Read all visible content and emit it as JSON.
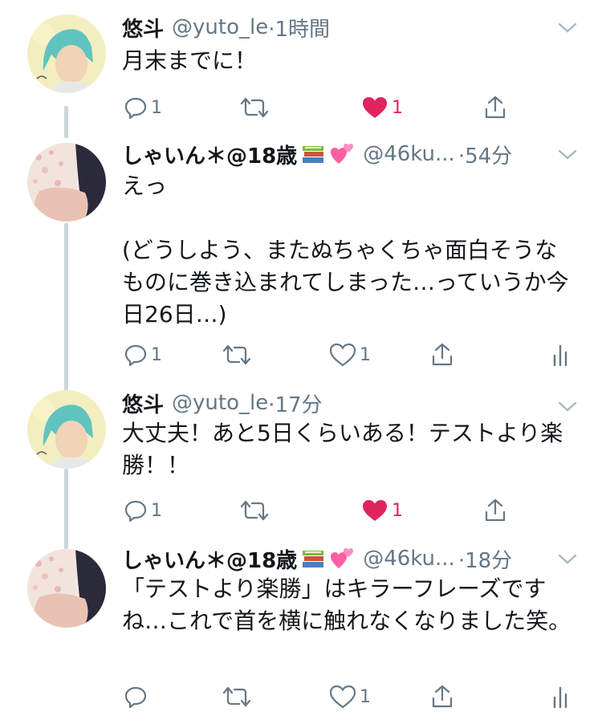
{
  "tweets": [
    {
      "name": "悠斗",
      "handle": "@yuto_le",
      "time": "·1時間",
      "text": "月末までに！",
      "reply_count": "1",
      "like_count": "1",
      "liked": true
    },
    {
      "name": "しゃいん＊@18歳",
      "handle": "@46ku...",
      "time": "·54分",
      "text": "えっ\n\n(どうしよう、またぬちゃくちゃ面白そうなものに巻き込まれてしまった…っていうか今日26日…)",
      "reply_count": "1",
      "like_count": "1",
      "liked": false
    },
    {
      "name": "悠斗",
      "handle": "@yuto_le",
      "time": "·17分",
      "text": "大丈夫！あと5日くらいある！テストより楽勝！！",
      "reply_count": "1",
      "like_count": "1",
      "liked": true
    },
    {
      "name": "しゃいん＊@18歳",
      "handle": "@46ku...",
      "time": "·18分",
      "text": "「テストより楽勝」はキラーフレーズですね…これで首を横に触れなくなりました笑。",
      "reply_count": "",
      "like_count": "1",
      "liked": false
    }
  ],
  "icons": [
    "reply-icon",
    "retweet-icon",
    "like-icon",
    "share-icon",
    "analytics-icon",
    "chevron-down-icon",
    "books-emoji-icon",
    "hearts-emoji-icon"
  ],
  "colors": {
    "like_active": "#e0245e",
    "secondary": "#657786",
    "thread_line": "#ccd6dd",
    "text": "#14171a"
  }
}
